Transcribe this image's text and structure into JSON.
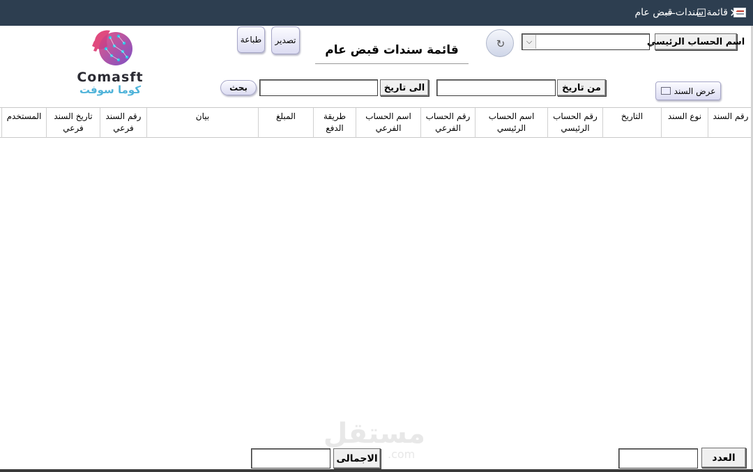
{
  "window": {
    "title": "قائمة سندات قبض عام",
    "controls": {
      "close": "✕",
      "maximize": "☐",
      "minimize": "—"
    }
  },
  "form": {
    "heading": "قائمة سندات قبض عام",
    "main_account_label": "اسم الحساب الرئيسي",
    "main_account_value": "",
    "dropdown_arrow": "⌵",
    "refresh_icon": "↻",
    "export_button": "تصدير",
    "print_button": "طباعة",
    "view_voucher_button": "عرض السند",
    "from_date_label": "من تاريخ",
    "from_date_value": "",
    "to_date_label": "الى  تاريخ",
    "to_date_value": "",
    "search_button": "بحث"
  },
  "logo": {
    "name_en": "Comasft",
    "name_ar": "كوما سوفت"
  },
  "table": {
    "columns": [
      {
        "line1": "رقم السند",
        "line2": ""
      },
      {
        "line1": "نوع السند",
        "line2": ""
      },
      {
        "line1": "التاريخ",
        "line2": ""
      },
      {
        "line1": "رقم الحساب",
        "line2": "الرئيسي"
      },
      {
        "line1": "اسم الحساب",
        "line2": "الرئيسي"
      },
      {
        "line1": "رقم الحساب",
        "line2": "الفرعي"
      },
      {
        "line1": "اسم الحساب",
        "line2": "الفرعي"
      },
      {
        "line1": "طريقة",
        "line2": "الدفع"
      },
      {
        "line1": "المبلغ",
        "line2": ""
      },
      {
        "line1": "بيان",
        "line2": ""
      },
      {
        "line1": "رقم السند",
        "line2": "فرعي"
      },
      {
        "line1": "تاريخ السند",
        "line2": "فرعي"
      },
      {
        "line1": "المستخدم",
        "line2": ""
      }
    ],
    "rows": []
  },
  "footer": {
    "count_label": "العدد",
    "count_value": "",
    "total_label": "الاجمالى",
    "total_value": ""
  },
  "watermark": {
    "text": "مستقل",
    "domain": ".com"
  }
}
